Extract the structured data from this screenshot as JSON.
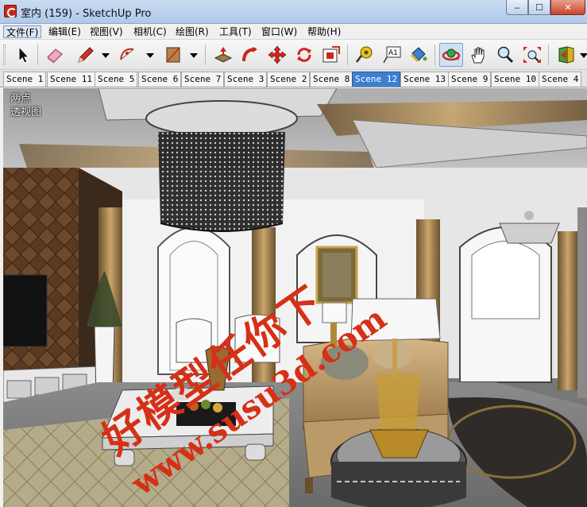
{
  "window": {
    "title": "室内 (159) - SketchUp Pro",
    "minimize_glyph": "‒",
    "maximize_glyph": "☐",
    "close_glyph": "✕"
  },
  "menu": [
    {
      "label": "文件(F)"
    },
    {
      "label": "编辑(E)"
    },
    {
      "label": "视图(V)"
    },
    {
      "label": "相机(C)"
    },
    {
      "label": "绘图(R)"
    },
    {
      "label": "工具(T)"
    },
    {
      "label": "窗口(W)"
    },
    {
      "label": "帮助(H)"
    }
  ],
  "toolbar": {
    "tools": [
      "select-icon",
      "eraser-icon",
      "pencil-icon",
      "arc-icon",
      "rectangle-icon",
      "push-pull-icon",
      "follow-me-icon",
      "move-icon",
      "rotate-icon",
      "offset-icon",
      "tape-measure-icon",
      "text-icon",
      "paint-bucket-icon",
      "orbit-icon",
      "pan-icon",
      "zoom-icon",
      "zoom-extents-icon",
      "previous-view-icon"
    ],
    "text_tool_label": "A1",
    "accent": "#3c7fd0"
  },
  "scenes": [
    {
      "label": "Scene 1"
    },
    {
      "label": "Scene 11"
    },
    {
      "label": "Scene 5"
    },
    {
      "label": "Scene 6"
    },
    {
      "label": "Scene 7"
    },
    {
      "label": "Scene 3"
    },
    {
      "label": "Scene 2"
    },
    {
      "label": "Scene 8"
    },
    {
      "label": "Scene 12",
      "active": true
    },
    {
      "label": "Scene 13"
    },
    {
      "label": "Scene 9"
    },
    {
      "label": "Scene 10"
    },
    {
      "label": "Scene 4"
    }
  ],
  "viewport": {
    "view_labels": [
      "两点",
      "透视图"
    ],
    "watermark_cn": "好模型任你下",
    "watermark_url": "www.susu3d.com",
    "watermark_color": "#d63016"
  }
}
